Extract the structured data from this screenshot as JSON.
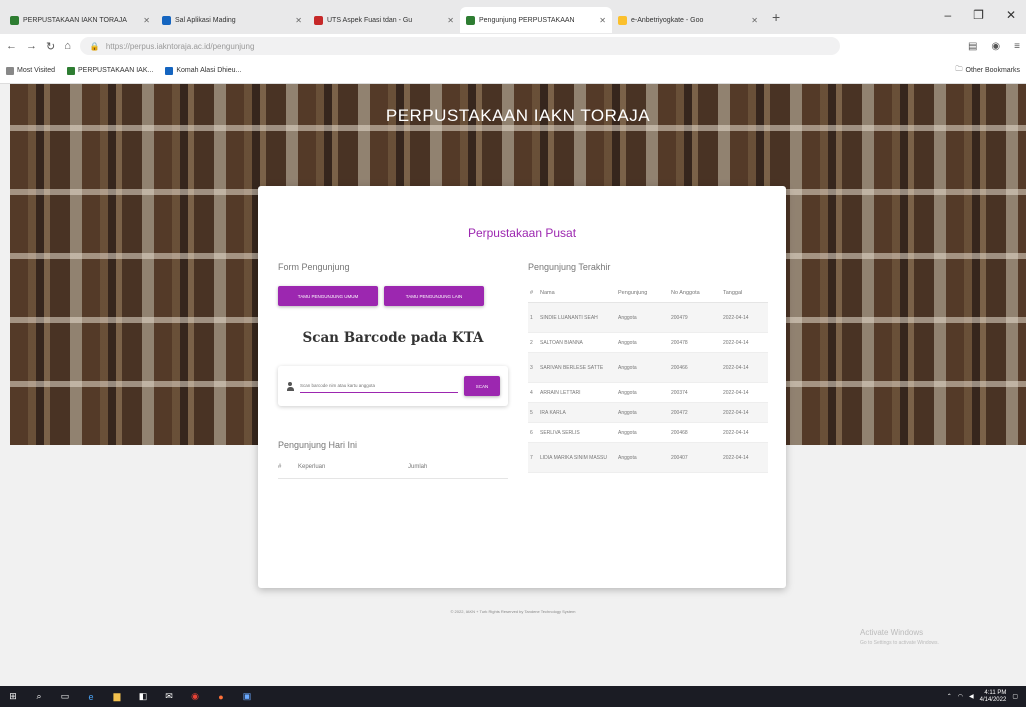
{
  "browser": {
    "tabs": [
      {
        "title": "PERPUSTAKAAN IAKN TORAJA",
        "color": "#2e7d32"
      },
      {
        "title": "Sal Aplikasi Mading",
        "color": "#1565c0"
      },
      {
        "title": "UTS Aspek Fuasi tdan - Gu",
        "color": "#c62828"
      },
      {
        "title": "Pengunjung PERPUSTAKAAN",
        "color": "#2e7d32"
      },
      {
        "title": "e-Anbetriyogkate - Goo",
        "color": "#fbc02d"
      }
    ],
    "new_tab": "+",
    "url": "https://perpus.iakntoraja.ac.id/pengunjung",
    "bookmarks": [
      {
        "label": "Most Visited",
        "color": "#888888"
      },
      {
        "label": "PERPUSTAKAAN IAK...",
        "color": "#2e7d32"
      },
      {
        "label": "Komah Alasi Dhieu...",
        "color": "#1565c0"
      }
    ],
    "bookmarks_right": "Other Bookmarks"
  },
  "hero": {
    "title": "PERPUSTAKAAN IAKN TORAJA"
  },
  "card": {
    "title": "Perpustakaan Pusat",
    "form_label": "Form Pengunjung",
    "btn_anggota": "TAMU PENGUNJUNG UMUM",
    "btn_umum": "TAMU PENGUNJUNG LAIN",
    "scan_title": "Scan Barcode pada KTA",
    "scan_placeholder": "Scan barcode nim atau kartu anggota",
    "btn_cari": "SCAN",
    "today_label": "Pengunjung Hari Ini",
    "today_cols": [
      "#",
      "Keperluan",
      "Jumlah"
    ],
    "table_label": "Pengunjung Terakhir",
    "table_cols": [
      "#",
      "Nama",
      "Pengunjung",
      "No Anggota",
      "Tanggal"
    ],
    "rows": [
      {
        "no": "1",
        "nama": "SINDIE LUANANTI SEAH",
        "jenis": "Anggota",
        "no_anggota": "200479",
        "tanggal": "2022-04-14",
        "tall": true
      },
      {
        "no": "2",
        "nama": "SALTOAN BIANNA",
        "jenis": "Anggota",
        "no_anggota": "200478",
        "tanggal": "2022-04-14",
        "tall": false
      },
      {
        "no": "3",
        "nama": "SARIVAN BERLESE SATTE",
        "jenis": "Anggota",
        "no_anggota": "200466",
        "tanggal": "2022-04-14",
        "tall": true
      },
      {
        "no": "4",
        "nama": "ARRAIN LETTARI",
        "jenis": "Anggota",
        "no_anggota": "200374",
        "tanggal": "2022-04-14",
        "tall": false
      },
      {
        "no": "5",
        "nama": "IRA KARLA",
        "jenis": "Anggota",
        "no_anggota": "200472",
        "tanggal": "2022-04-14",
        "tall": false
      },
      {
        "no": "6",
        "nama": "SERLIVA SERLIS",
        "jenis": "Anggota",
        "no_anggota": "200468",
        "tanggal": "2022-04-14",
        "tall": false
      },
      {
        "no": "7",
        "nama": "LIDIA MARIKA SINIM MASSU",
        "jenis": "Anggota",
        "no_anggota": "200407",
        "tanggal": "2022-04-14",
        "tall": true
      }
    ]
  },
  "footer": "© 2022, IAKN + Turk Rights Reserved by Tandene Technology System",
  "activate": {
    "title": "Activate Windows",
    "sub": "Go to Settings to activate Windows."
  },
  "taskbar": {
    "time": "4:11 PM",
    "date": "4/14/2022"
  },
  "accent": "#9c27b0"
}
